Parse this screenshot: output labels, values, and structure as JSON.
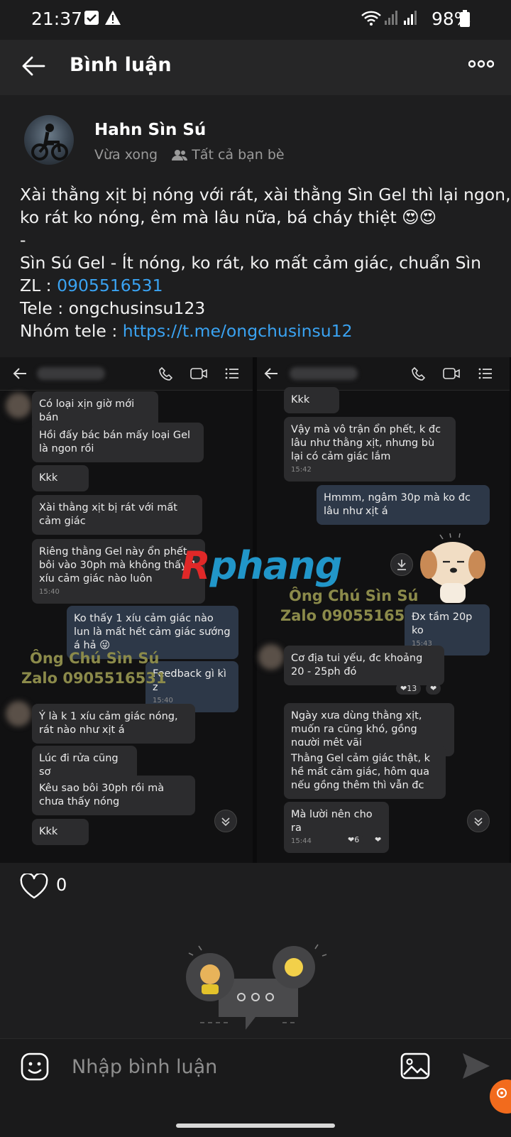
{
  "status_bar": {
    "time": "21:37",
    "battery": "98%"
  },
  "header": {
    "title": "Bình luận"
  },
  "post": {
    "author": "Hahn Sìn Sú",
    "time": "Vừa xong",
    "audience": "Tất cả bạn bè",
    "lines": [
      "Xài thằng xịt bị nóng với rát, xài thằng Sìn Gel thì lại ngon,",
      "ko rát ko nóng, êm mà lâu nữa, bá cháy thiệt 😍😍",
      "-",
      "Sìn Sú Gel - Ít nóng, ko rát, ko mất cảm giác, chuẩn Sìn"
    ],
    "zl_label": "ZL : ",
    "zl_value": "0905516531",
    "tele_line": "Tele : ongchusinsu123",
    "group_label": "Nhóm tele : ",
    "group_link": "https://t.me/ongchusinsu12"
  },
  "screenshot": {
    "left": {
      "messages": [
        {
          "text": "Có loại xịn giờ mới bán",
          "time": ""
        },
        {
          "text": "Hồi đấy bác bán mấy loại Gel là ngon rồi",
          "time": ""
        },
        {
          "text": "Kkk",
          "time": ""
        },
        {
          "text": "Xài thằng xịt bị rát với mất cảm giác",
          "time": ""
        },
        {
          "text": "Riêng thằng Gel này ổn phết, bôi vào 30ph mà không thấy 1 xíu cảm giác nào luôn",
          "time": "15:40"
        },
        {
          "text": "Ko thấy 1 xíu cảm giác nào lun là mất hết cảm giác sướng á hả 😜",
          "time": ""
        },
        {
          "text": "Feedback gì kì z",
          "time": "15:40"
        },
        {
          "text": "Ý là k 1 xíu cảm giác nóng, rát nào như xịt á",
          "time": ""
        },
        {
          "text": "Lúc đi rửa cũng sợ",
          "time": ""
        },
        {
          "text": "Kêu sao bôi 30ph rồi mà chưa thấy nóng",
          "time": ""
        },
        {
          "text": "Kkk",
          "time": ""
        }
      ],
      "watermark": [
        "Ông Chú Sìn Sú",
        "Zalo 0905516531"
      ]
    },
    "right": {
      "messages": [
        {
          "text": "Kkk",
          "time": ""
        },
        {
          "text": "Vậy mà vô trận ổn phết, k đc lâu như thằng xịt, nhưng bù lại có cảm giác lắm",
          "time": "15:42"
        },
        {
          "text": "Hmmm, ngâm 30p mà ko đc lâu như xịt á",
          "time": ""
        },
        {
          "text": "Đx tầm 20p ko",
          "time": "15:43"
        },
        {
          "text": "Cơ địa tui yếu, đc khoảng 20 - 25ph đó",
          "time": ""
        },
        {
          "text": "Ngày xưa dùng thằng xịt, muốn ra cũng khó, gồng người mệt vãi",
          "time": ""
        },
        {
          "text": "Thằng Gel cảm giác thật, k hề mất cảm giác, hôm qua nếu gồng thêm thì vẫn đc",
          "time": ""
        },
        {
          "text": "Mà lười nên cho ra",
          "time": "15:44"
        }
      ],
      "watermark": [
        "Ông Chú Sìn Sú",
        "Zalo 0905516531"
      ],
      "reaction_a": "❤13",
      "reaction_b": "❤6"
    },
    "logo_r": "R",
    "logo_rest": "phang"
  },
  "reactions": {
    "like_count": "0"
  },
  "composer": {
    "placeholder": "Nhập bình luận"
  },
  "colors": {
    "link": "#3aa3f2",
    "background": "#1e1e1f",
    "notif": "#f26b1d"
  },
  "icons": [
    "back-arrow-icon",
    "more-icon",
    "friends-icon",
    "heart-icon",
    "emoji-icon",
    "image-icon",
    "send-icon"
  ]
}
